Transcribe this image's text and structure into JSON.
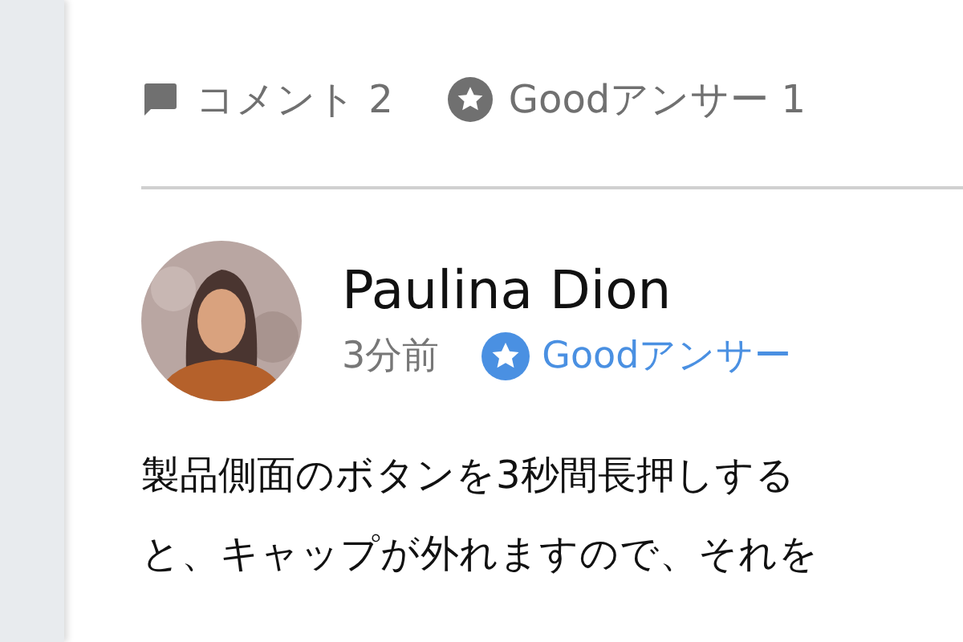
{
  "stats": [
    {
      "kind": "comment",
      "label": "コメント 2"
    },
    {
      "kind": "good-answer",
      "label": "Goodアンサー 1"
    }
  ],
  "answer": {
    "author": "Paulina Dion",
    "time": "3分前",
    "badge": {
      "label": "Goodアンサー"
    },
    "body_lines": [
      "製品側面のボタンを3秒間長押しする",
      "と、キャップが外れますので、それを"
    ]
  }
}
